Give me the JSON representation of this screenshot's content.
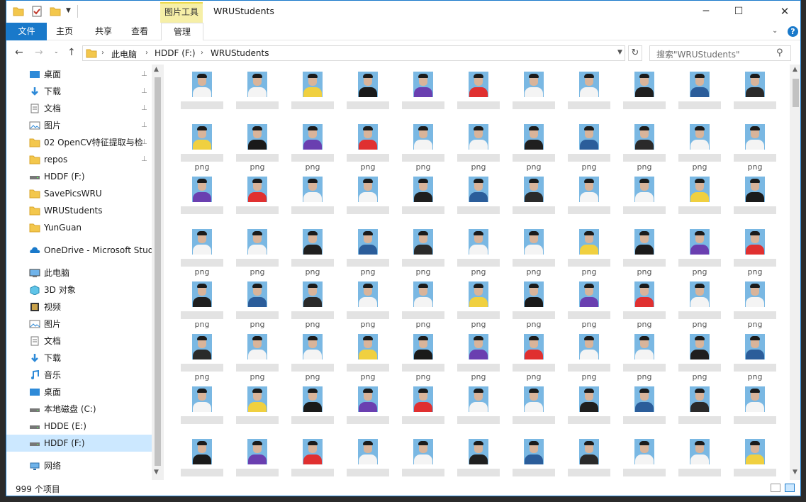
{
  "window": {
    "title": "WRUStudents",
    "context_tab_header": "图片工具",
    "minimize_glyph": "─",
    "maximize_glyph": "☐",
    "close_glyph": "✕"
  },
  "ribbon": {
    "tabs": [
      "文件",
      "主页",
      "共享",
      "查看",
      "管理"
    ],
    "expand_glyph": "⌄",
    "help_glyph": "?"
  },
  "navbar": {
    "back_glyph": "←",
    "forward_glyph": "→",
    "recent_glyph": "⌄",
    "up_glyph": "↑",
    "refresh_glyph": "↻",
    "breadcrumb": [
      "此电脑",
      "HDDF (F:)",
      "WRUStudents"
    ],
    "breadcrumb_sep": "›",
    "search_placeholder": "搜索\"WRUStudents\"",
    "search_glyph": "⚲"
  },
  "sidebar": {
    "items": [
      {
        "label": "桌面",
        "icon": "desktop-icon",
        "pinned": true
      },
      {
        "label": "下载",
        "icon": "download-icon",
        "pinned": true
      },
      {
        "label": "文档",
        "icon": "documents-icon",
        "pinned": true
      },
      {
        "label": "图片",
        "icon": "pictures-icon",
        "pinned": true
      },
      {
        "label": "02 OpenCV特征提取与检",
        "icon": "folder-icon",
        "pinned": true
      },
      {
        "label": "repos",
        "icon": "folder-icon",
        "pinned": true
      },
      {
        "label": "HDDF (F:)",
        "icon": "drive-icon",
        "pinned": false
      },
      {
        "label": "SavePicsWRU",
        "icon": "folder-icon",
        "pinned": false
      },
      {
        "label": "WRUStudents",
        "icon": "folder-icon",
        "pinned": false
      },
      {
        "label": "YunGuan",
        "icon": "folder-icon",
        "pinned": false
      },
      {
        "label": "OneDrive - Microsoft Stude",
        "icon": "onedrive-icon",
        "pinned": false
      },
      {
        "label": "此电脑",
        "icon": "this-pc-icon",
        "pinned": false
      },
      {
        "label": "3D 对象",
        "icon": "3d-objects-icon",
        "pinned": false
      },
      {
        "label": "视频",
        "icon": "videos-icon",
        "pinned": false
      },
      {
        "label": "图片",
        "icon": "pictures-icon",
        "pinned": false
      },
      {
        "label": "文档",
        "icon": "documents-icon",
        "pinned": false
      },
      {
        "label": "下载",
        "icon": "download-icon",
        "pinned": false
      },
      {
        "label": "音乐",
        "icon": "music-icon",
        "pinned": false
      },
      {
        "label": "桌面",
        "icon": "desktop-icon",
        "pinned": false
      },
      {
        "label": "本地磁盘 (C:)",
        "icon": "drive-icon",
        "pinned": false
      },
      {
        "label": "HDDE (E:)",
        "icon": "drive-icon",
        "pinned": false
      },
      {
        "label": "HDDF (F:)",
        "icon": "drive-icon",
        "pinned": false,
        "selected": true
      },
      {
        "label": "网络",
        "icon": "network-icon",
        "pinned": false
      }
    ],
    "pin_glyph": "📌"
  },
  "files": {
    "extension_label": "png",
    "row_extension_shown": [
      false,
      true,
      false,
      true,
      true,
      true,
      false,
      false
    ]
  },
  "status": {
    "item_count": "999 个项目"
  },
  "colors": {
    "accent": "#1979ca",
    "context_tab": "#f6efa7",
    "selection": "#cce8ff",
    "photo_bg": "#7ab8e3"
  }
}
